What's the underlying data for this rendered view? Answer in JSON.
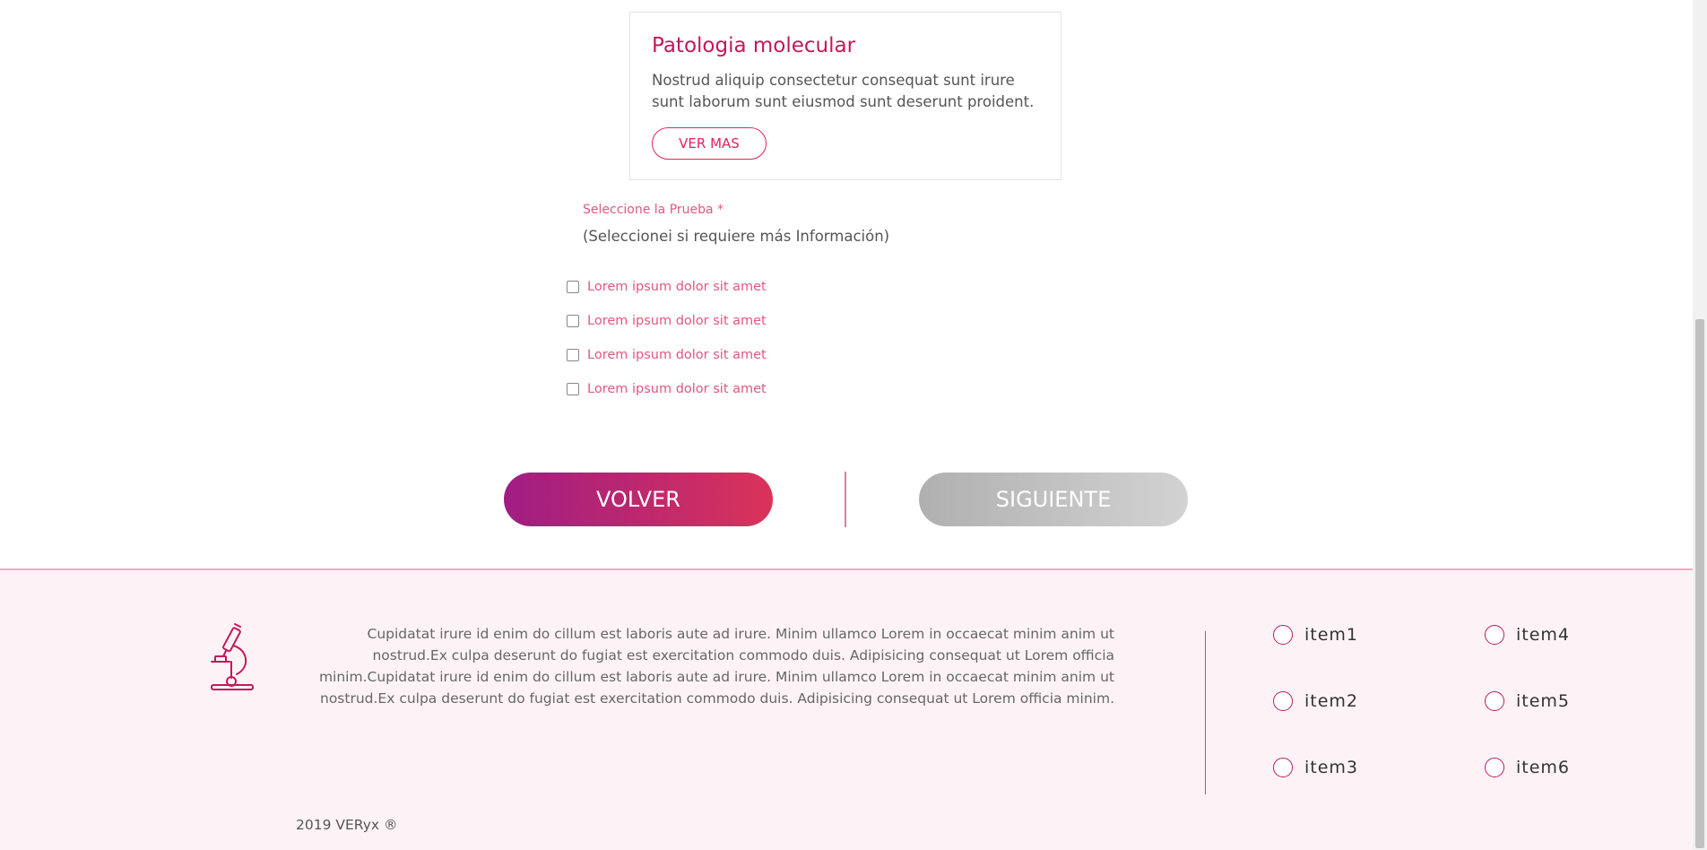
{
  "card": {
    "title": "Patologia molecular",
    "description": "Nostrud aliquip consectetur consequat sunt irure sunt laborum sunt eiusmod sunt deserunt proident.",
    "button_label": "VER MAS"
  },
  "select": {
    "label": "Seleccione la Prueba *",
    "value": "(Seleccionei si requiere más Información)"
  },
  "checkboxes": [
    {
      "label": "Lorem ipsum dolor sit amet",
      "checked": false
    },
    {
      "label": "Lorem ipsum dolor sit amet",
      "checked": false
    },
    {
      "label": "Lorem ipsum dolor sit amet",
      "checked": false
    },
    {
      "label": "Lorem ipsum dolor sit amet",
      "checked": false
    }
  ],
  "nav": {
    "back_label": "VOLVER",
    "next_label": "SIGUIENTE"
  },
  "footer": {
    "icon": "microscope-icon",
    "text": "Cupidatat irure id enim do cillum est laboris aute ad irure. Minim ullamco Lorem in occaecat minim anim ut nostrud.Ex culpa deserunt do fugiat est exercitation commodo duis. Adipisicing consequat ut Lorem officia minim.Cupidatat irure id enim do cillum est laboris aute ad irure. Minim ullamco Lorem in occaecat minim anim ut nostrud.Ex culpa deserunt do fugiat est exercitation commodo duis. Adipisicing consequat ut Lorem officia minim.",
    "options": [
      {
        "label": "item1"
      },
      {
        "label": "item2"
      },
      {
        "label": "item3"
      },
      {
        "label": "item4"
      },
      {
        "label": "item5"
      },
      {
        "label": "item6"
      }
    ],
    "copyright": "2019 VERyx ®"
  },
  "colors": {
    "accent": "#c2185b",
    "accent_light": "#e2577f",
    "gradient_start": "#a01d83",
    "gradient_end": "#d9335a",
    "disabled": "#c0c0c0",
    "footer_bg": "#fdf3f6"
  }
}
